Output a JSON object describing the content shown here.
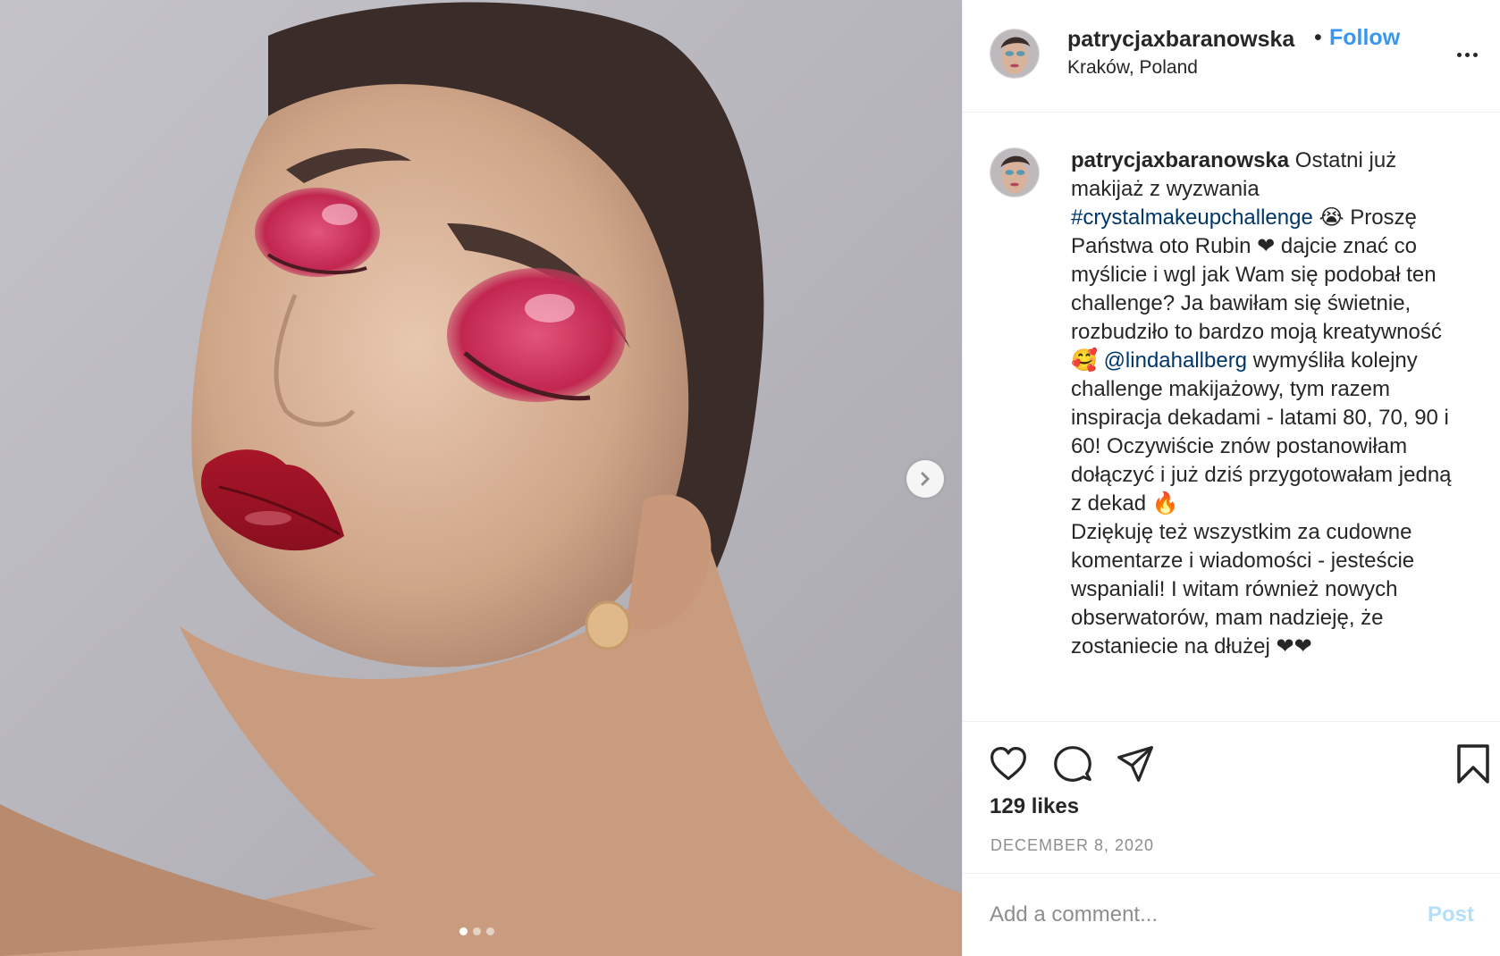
{
  "post": {
    "username": "patrycjaxbaranowska",
    "separator": "•",
    "follow_label": "Follow",
    "location": "Kraków, Poland",
    "more_icon": "more-horizontal-icon",
    "caption_part1": " Ostatni już makijaż z wyzwania ",
    "hashtag": "#crystalmakeupchallenge",
    "caption_part2": " 😭 Proszę Państwa oto Rubin ❤ dajcie znać co myślicie i wgl jak Wam się podobał ten challenge? Ja bawiłam się świetnie, rozbudziło to bardzo moją kreatywność 🥰 ",
    "mention": "@lindahallberg",
    "caption_part3": " wymyśliła kolejny challenge makijażowy, tym razem inspiracja dekadami - latami 80, 70, 90 i 60! Oczywiście znów postanowiłam dołączyć i już dziś przygotowałam jedną z dekad 🔥\nDziękuję też wszystkim za cudowne komentarze i wiadomości - jesteście wspaniali! I witam również nowych obserwatorów, mam nadzieję, że zostaniecie na dłużej ❤❤",
    "likes": "129 likes",
    "date": "DECEMBER 8, 2020",
    "comment_placeholder": "Add a comment...",
    "post_label": "Post",
    "carousel": {
      "slide_count": 3,
      "active_slide": 1
    },
    "colors": {
      "follow": "#3897f0",
      "link": "#00376b",
      "post_disabled": "#b2dffc",
      "muted": "#8e8e8e"
    }
  }
}
